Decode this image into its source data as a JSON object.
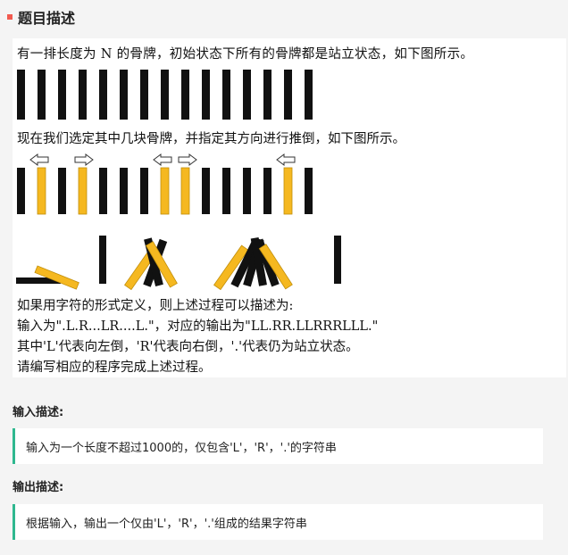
{
  "header": {
    "title": "题目描述"
  },
  "panel": {
    "line1": "有一排长度为 N 的骨牌，初始状态下所有的骨牌都是站立状态，如下图所示。",
    "line2": "现在我们选定其中几块骨牌，并指定其方向进行推倒，如下图所示。",
    "line3": "如果用字符的形式定义，则上述过程可以描述为:",
    "line4": "输入为\".L.R...LR....L.\"，对应的输出为\"LL.RR.LLRRRLLL.\"",
    "line5": "其中'L'代表向左倒，'R'代表向右倒，'.'代表仍为站立状态。",
    "line6": "请编写相应的程序完成上述过程。"
  },
  "input_section": {
    "title": "输入描述:",
    "text": "输入为一个长度不超过1000的，仅包含'L'，'R'，'.'的字符串"
  },
  "output_section": {
    "title": "输出描述:",
    "text": "根据输入，输出一个仅由'L'，'R'，'.'组成的结果字符串"
  },
  "colors": {
    "accent_marker": "#f25a4f",
    "box_border": "#2fb88f",
    "domino_black": "#111111",
    "domino_yellow": "#f5b820"
  },
  "icons": [
    "left-arrow-icon",
    "right-arrow-icon"
  ]
}
